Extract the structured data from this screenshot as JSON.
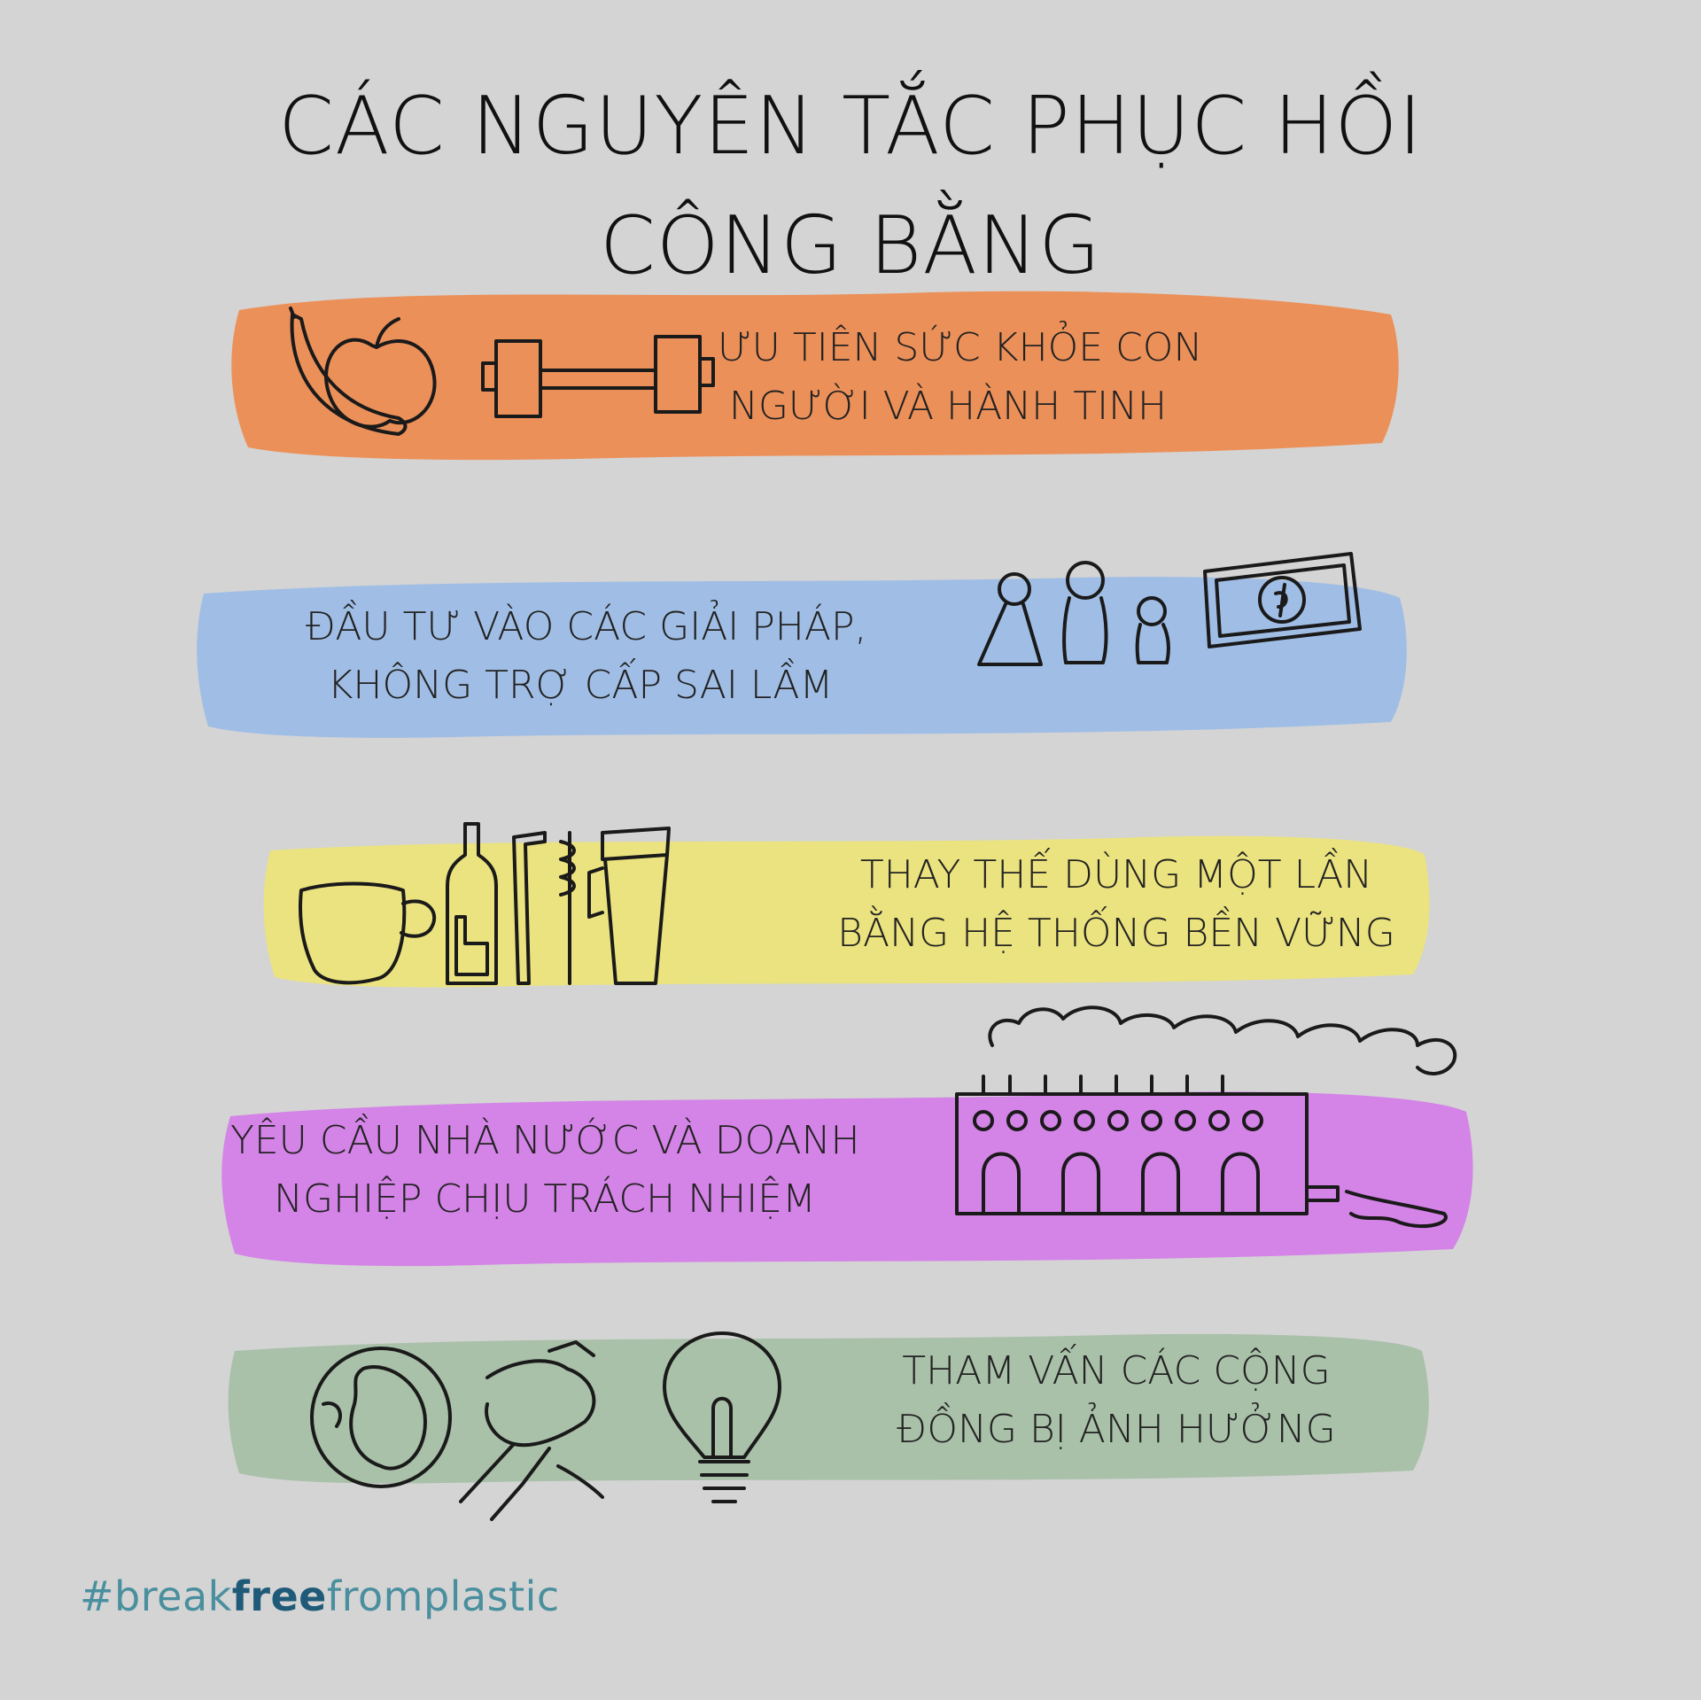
{
  "title": {
    "line1": "CÁC NGUYÊN TẮC PHỤC HỒI",
    "line2": "CÔNG BẰNG"
  },
  "principles": [
    {
      "color": "#ee8a4e",
      "line1": "ƯU TIÊN SỨC KHỎE CON",
      "line2": "NGƯỜI VÀ HÀNH TINH",
      "icons": [
        "banana-icon",
        "apple-icon",
        "dumbbell-icon"
      ]
    },
    {
      "color": "#9dbde6",
      "line1": "ĐẦU TƯ VÀO CÁC GIẢI PHÁP,",
      "line2": "KHÔNG TRỢ CẤP  SAI LẦM",
      "icons": [
        "people-icon",
        "money-icon"
      ]
    },
    {
      "color": "#ece47a",
      "line1": "THAY THẾ DÙNG MỘT LẦN",
      "line2": "BẰNG HỆ THỐNG BỀN VỮNG",
      "icons": [
        "mug-icon",
        "bottle-icon",
        "straw-icon",
        "brush-icon",
        "jug-icon"
      ]
    },
    {
      "color": "#d47ee8",
      "line1": "YÊU CẦU NHÀ NƯỚC VÀ DOANH",
      "line2": "NGHIỆP CHỊU TRÁCH NHIỆM",
      "icons": [
        "factory-icon"
      ]
    },
    {
      "color": "#a6bfa6",
      "line1": "THAM VẤN CÁC CỘNG",
      "line2": "ĐỒNG BỊ ẢNH HƯỞNG",
      "icons": [
        "globe-icon",
        "handshake-icon",
        "lightbulb-icon"
      ]
    }
  ],
  "hashtag": {
    "prefix": "#break",
    "bold": "free",
    "suffix": "fromplastic"
  }
}
